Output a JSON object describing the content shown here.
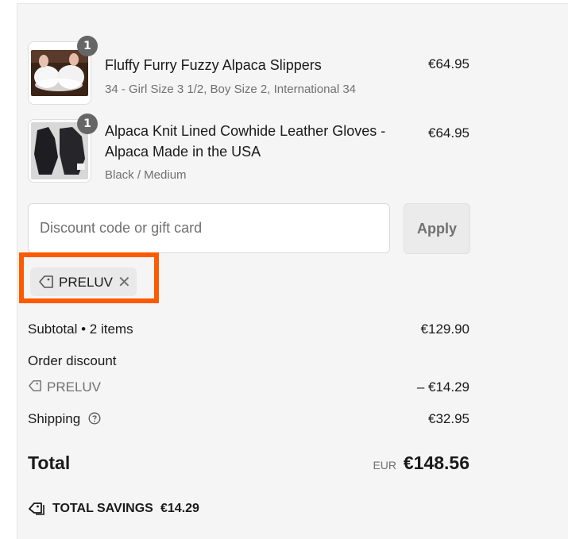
{
  "items": [
    {
      "title": "Fluffy Furry Fuzzy Alpaca Slippers",
      "variant": "34 - Girl Size 3 1/2, Boy Size 2, International 34",
      "price": "€64.95",
      "quantity": "1"
    },
    {
      "title": "Alpaca Knit Lined Cowhide Leather Gloves - Alpaca Made in the USA",
      "variant": "Black / Medium",
      "price": "€64.95",
      "quantity": "1"
    }
  ],
  "discount": {
    "placeholder": "Discount code or gift card",
    "apply_label": "Apply",
    "applied_code": "PRELUV",
    "remove_glyph": "✕"
  },
  "summary": {
    "subtotal_label": "Subtotal • 2 items",
    "subtotal_value": "€129.90",
    "order_discount_label": "Order discount",
    "discount_code": "PRELUV",
    "discount_value": "– €14.29",
    "shipping_label": "Shipping",
    "shipping_value": "€32.95",
    "total_label": "Total",
    "currency": "EUR",
    "total_value": "€148.56",
    "savings_label": "TOTAL SAVINGS",
    "savings_value": "€14.29"
  },
  "colors": {
    "highlight": "#ff5a00",
    "panel_bg": "#f5f5f5",
    "badge": "#666666"
  },
  "icons": [
    "tag-icon",
    "close-icon",
    "question-circle-icon",
    "tags-icon"
  ]
}
